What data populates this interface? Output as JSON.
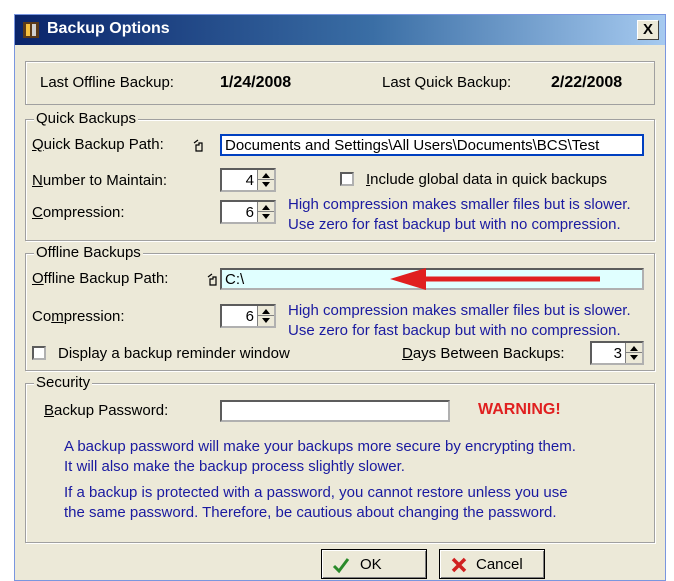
{
  "window": {
    "title": "Backup Options",
    "close_label": "X"
  },
  "summary": {
    "last_offline_label": "Last Offline Backup:",
    "last_offline_value": "1/24/2008",
    "last_quick_label": "Last Quick Backup:",
    "last_quick_value": "2/22/2008"
  },
  "quick": {
    "group_label": "Quick Backups",
    "path_label": "Quick Backup Path:",
    "path_value": "Documents and Settings\\All Users\\Documents\\BCS\\Test",
    "number_label": "Number to Maintain:",
    "number_value": "4",
    "include_global_label": "Include global data in quick backups",
    "compression_label": "Compression:",
    "compression_value": "6",
    "hint_line1": "High compression makes smaller files but is slower.",
    "hint_line2": "Use zero for fast backup but with no compression."
  },
  "offline": {
    "group_label": "Offline Backups",
    "path_label": "Offline Backup Path:",
    "path_value": "C:\\",
    "compression_label": "Compression:",
    "compression_value": "6",
    "hint_line1": "High compression makes smaller files but is slower.",
    "hint_line2": "Use zero for fast backup but with no compression.",
    "reminder_label": "Display a backup reminder window",
    "days_label": "Days Between Backups:",
    "days_value": "3"
  },
  "security": {
    "group_label": "Security",
    "password_label": "Backup Password:",
    "password_value": "",
    "warning": "WARNING!",
    "note1_line1": "A backup password will make your backups more secure by encrypting them.",
    "note1_line2": "It will also make the backup process slightly slower.",
    "note2_line1": "If a backup is protected with a password, you cannot restore unless you use",
    "note2_line2": "the same password.  Therefore, be cautious about changing the password."
  },
  "buttons": {
    "ok_label": "OK",
    "cancel_label": "Cancel"
  },
  "colors": {
    "arrow": "#e02020",
    "info_text": "#1a1aa0",
    "warning": "#e02020"
  },
  "icons": [
    "app-icon",
    "folder-browse-icon",
    "check-icon",
    "x-cancel-icon",
    "red-arrow-icon"
  ]
}
